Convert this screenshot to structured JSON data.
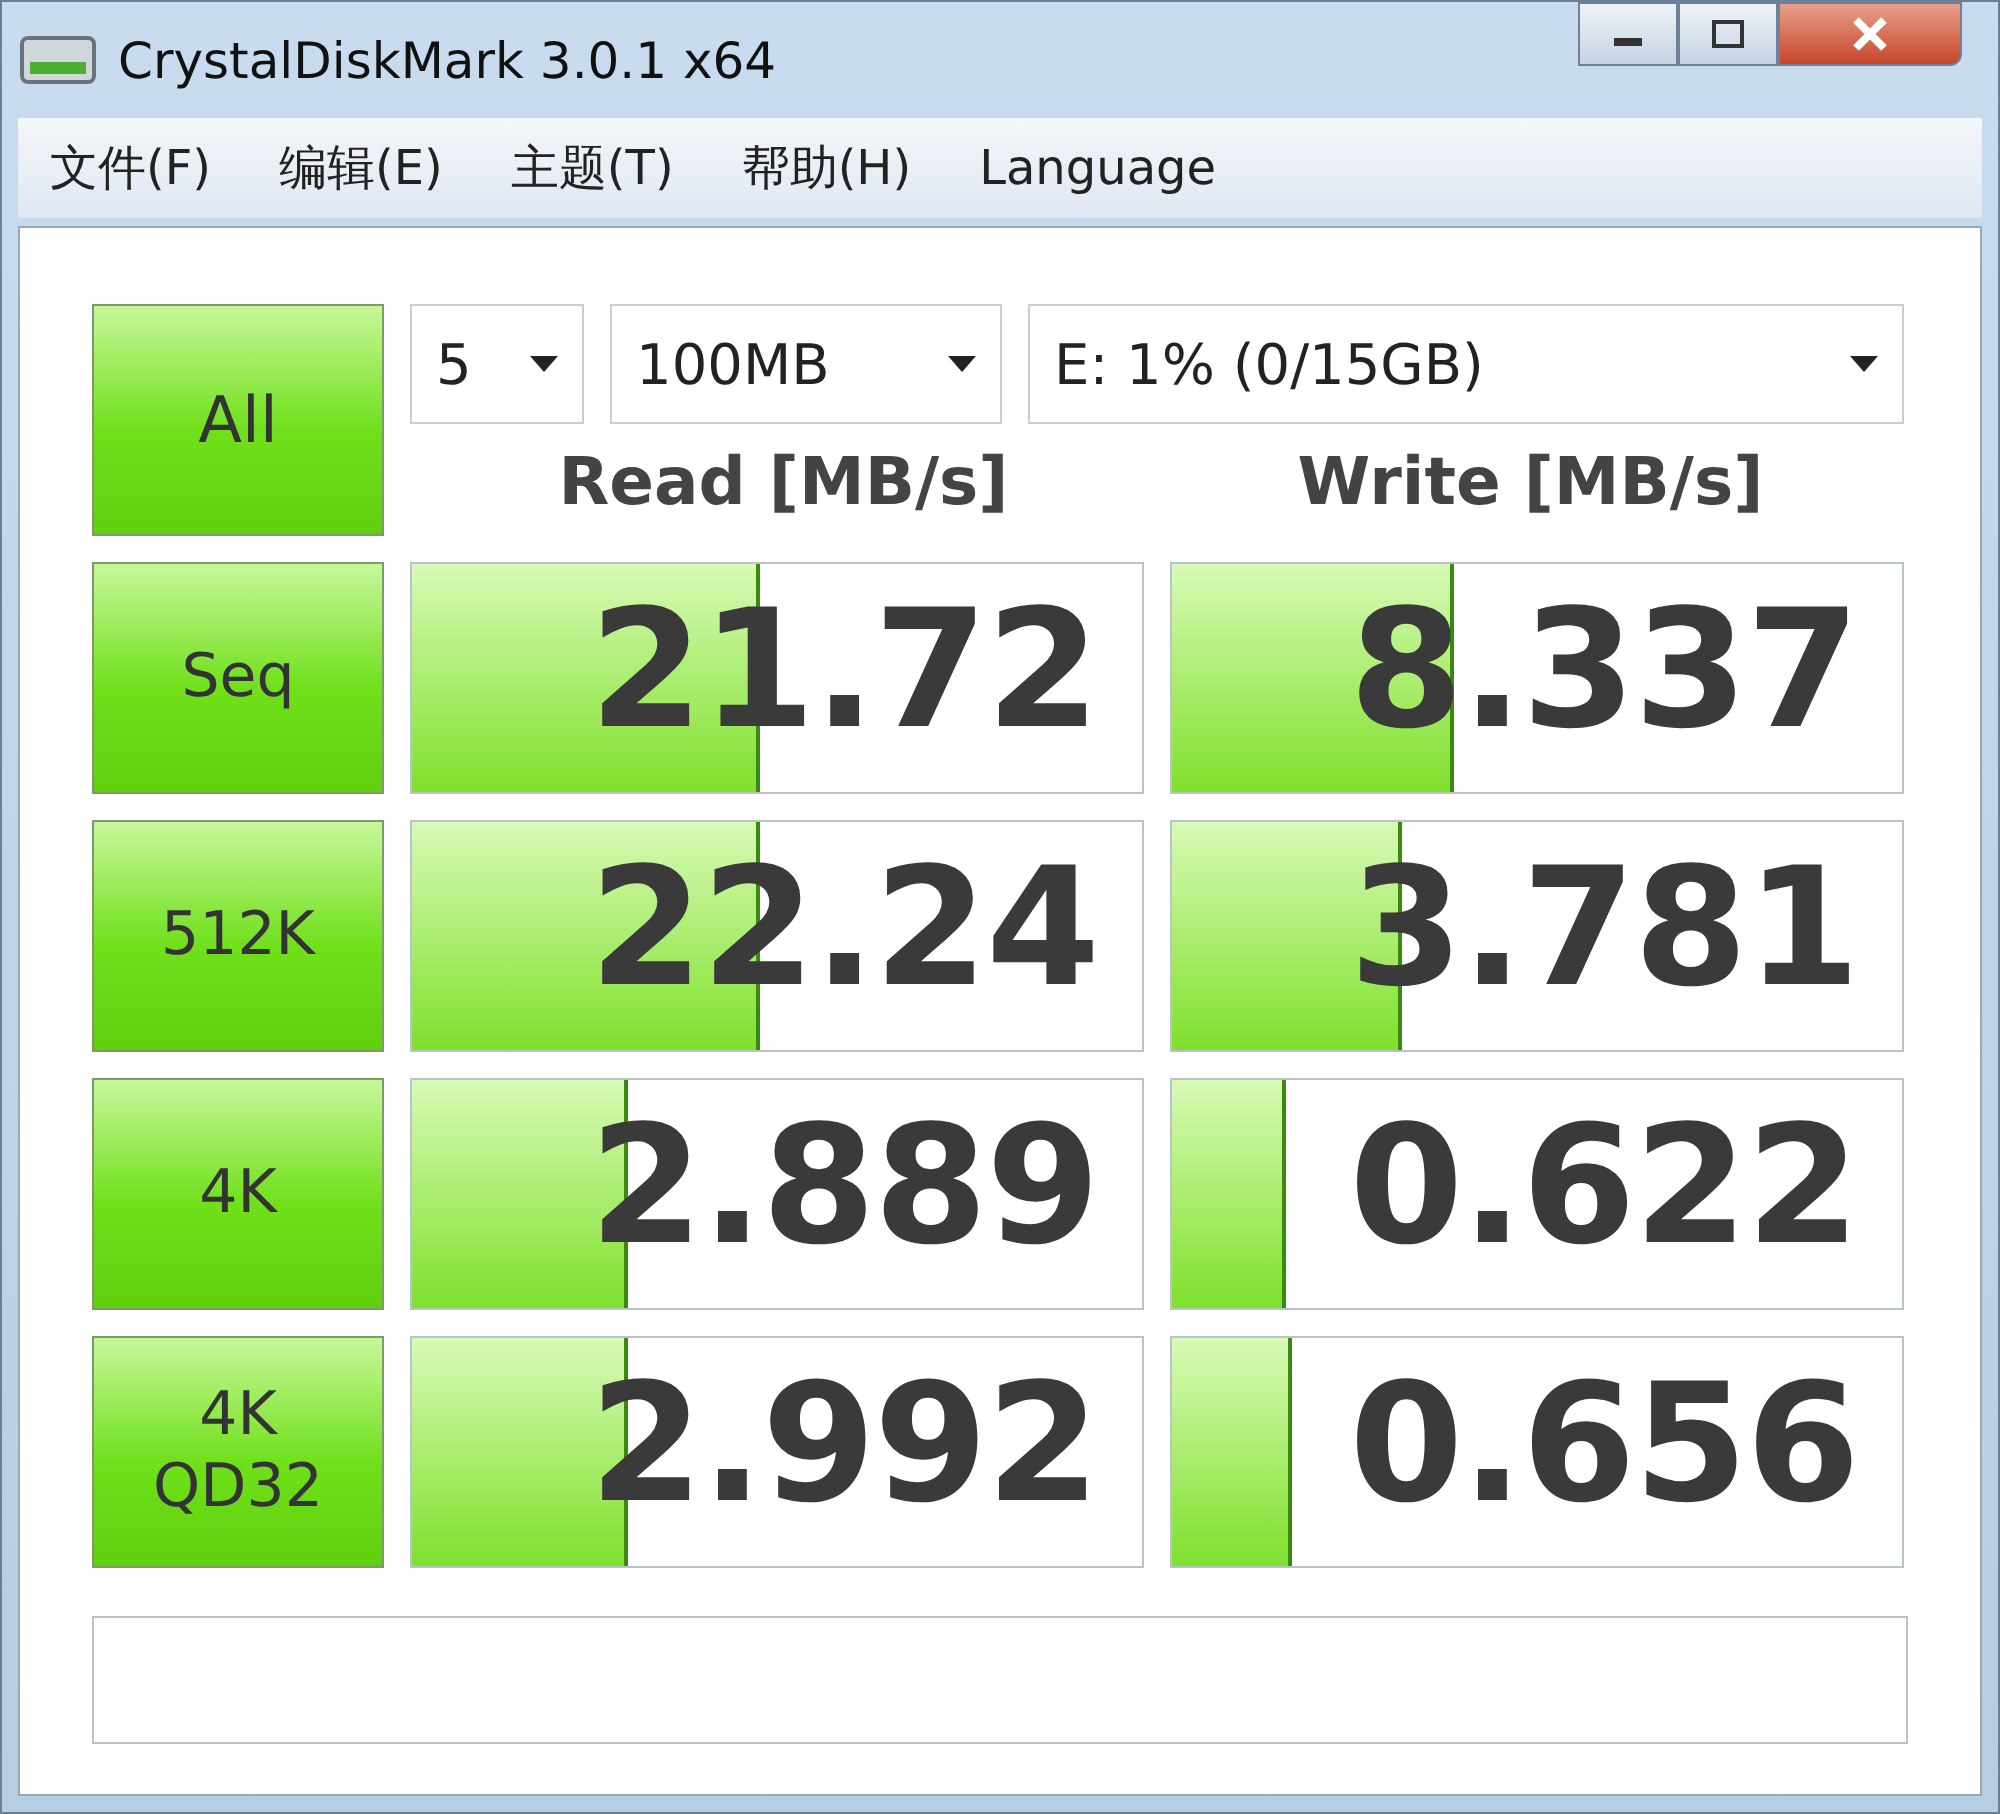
{
  "window": {
    "title": "CrystalDiskMark 3.0.1 x64"
  },
  "menu": [
    "文件(F)",
    "编辑(E)",
    "主题(T)",
    "帮助(H)",
    "Language"
  ],
  "all_button": "All",
  "selects": {
    "count": "5",
    "size": "100MB",
    "drive": "E: 1% (0/15GB)"
  },
  "headers": {
    "read": "Read [MB/s]",
    "write": "Write [MB/s]"
  },
  "rows": [
    {
      "label": "Seq",
      "read": {
        "value": "21.72",
        "level": 0.47
      },
      "write": {
        "value": "8.337",
        "level": 0.38
      }
    },
    {
      "label": "512K",
      "read": {
        "value": "22.24",
        "level": 0.47
      },
      "write": {
        "value": "3.781",
        "level": 0.31
      }
    },
    {
      "label": "4K",
      "read": {
        "value": "2.889",
        "level": 0.29
      },
      "write": {
        "value": "0.622",
        "level": 0.15
      }
    },
    {
      "label": "4K\nQD32",
      "read": {
        "value": "2.992",
        "level": 0.29
      },
      "write": {
        "value": "0.656",
        "level": 0.16
      }
    }
  ]
}
